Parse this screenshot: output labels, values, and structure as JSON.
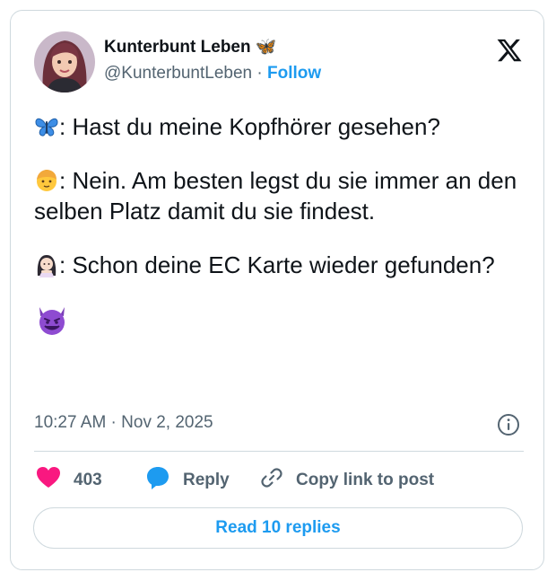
{
  "author": {
    "name": "Kunterbunt Leben 🦋",
    "handle": "@KunterbuntLeben",
    "separator": "·",
    "follow_label": "Follow"
  },
  "tweet": {
    "lines": [
      {
        "speaker_icon": "butterfly-emoji",
        "text": ": Hast du meine Kopfhörer gesehen?"
      },
      {
        "speaker_icon": "man-emoji",
        "text": ": Nein. Am besten legst du sie immer an den selben Platz damit du sie findest."
      },
      {
        "speaker_icon": "woman-emoji",
        "text": ": Schon deine EC Karte wieder gefunden?"
      }
    ],
    "closing_icon": "smiling-devil-emoji"
  },
  "timestamp": "10:27 AM · Nov 2, 2025",
  "actions": {
    "like_count": "403",
    "reply_label": "Reply",
    "copy_link_label": "Copy link to post"
  },
  "read_replies_label": "Read 10 replies",
  "colors": {
    "accent": "#1d9bf0",
    "heart": "#f91880",
    "text": "#0f1419",
    "muted": "#536471",
    "border": "#cfd9de"
  },
  "icons": {
    "brand": "x-logo-icon",
    "info": "info-icon",
    "like": "heart-icon",
    "reply": "reply-bubble-icon",
    "copy": "link-icon"
  }
}
